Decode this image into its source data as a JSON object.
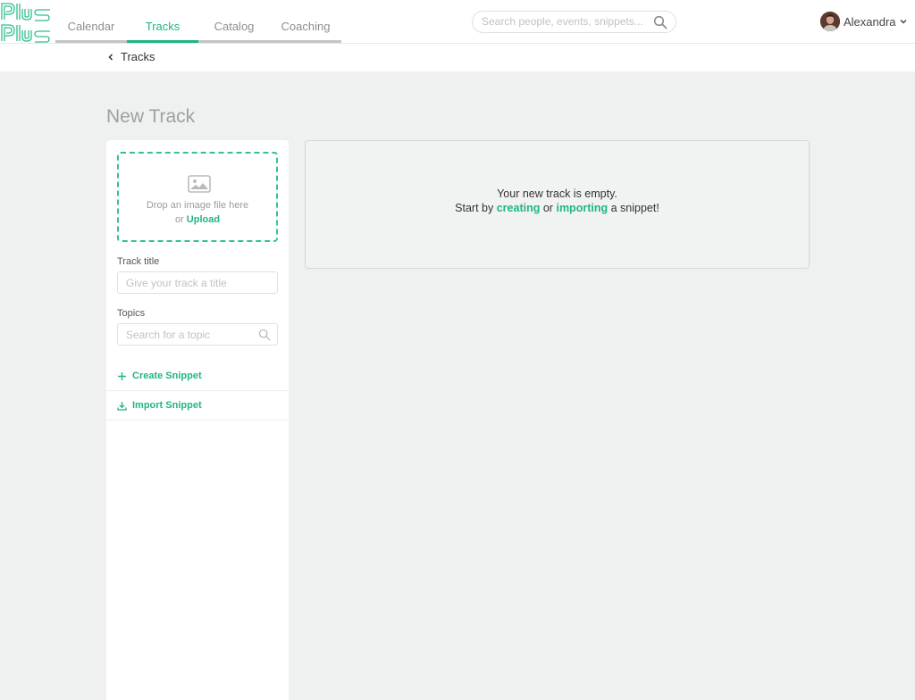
{
  "header": {
    "logo_text": "PlusPlus",
    "nav": [
      {
        "label": "Calendar",
        "active": false
      },
      {
        "label": "Tracks",
        "active": true
      },
      {
        "label": "Catalog",
        "active": false
      },
      {
        "label": "Coaching",
        "active": false
      }
    ],
    "search": {
      "placeholder": "Search people, events, snippets..."
    },
    "user": {
      "name": "Alexandra"
    }
  },
  "breadcrumb": {
    "label": "Tracks"
  },
  "page": {
    "title": "New Track"
  },
  "sidebar": {
    "dropzone": {
      "text": "Drop an image file here",
      "or": "or",
      "upload": "Upload"
    },
    "track_title": {
      "label": "Track title",
      "placeholder": "Give your track a title"
    },
    "topics": {
      "label": "Topics",
      "placeholder": "Search for a topic"
    },
    "actions": [
      {
        "label": "Create Snippet",
        "icon": "plus-icon"
      },
      {
        "label": "Import Snippet",
        "icon": "download-icon"
      }
    ]
  },
  "empty_state": {
    "line1": "Your new track is empty.",
    "start_by": "Start by",
    "creating": "creating",
    "or": "or",
    "importing": "importing",
    "suffix": "a snippet!"
  },
  "colors": {
    "accent": "#1fb77f",
    "background": "#eff1f0"
  }
}
